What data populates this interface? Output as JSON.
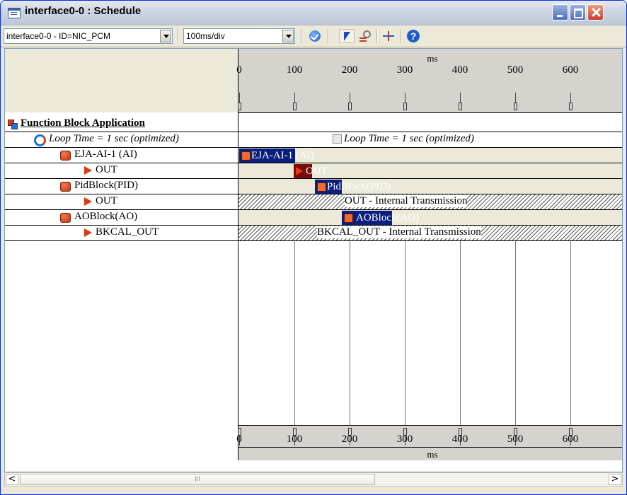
{
  "window": {
    "title": "interface0-0 : Schedule",
    "accent_color": "#0831d9",
    "icon": "schedule-window-icon"
  },
  "toolbar": {
    "interface_select": "interface0-0 - ID=NIC_PCM",
    "scale_select": "100ms/div",
    "buttons": [
      "validate-icon",
      "select-pointer-icon",
      "find-icon",
      "split-icon",
      "help-icon"
    ],
    "help_glyph": "?"
  },
  "timeline": {
    "units": "ms",
    "ticks": [
      "0",
      "100",
      "200",
      "300",
      "400",
      "500",
      "600"
    ]
  },
  "tree": {
    "root": "Function Block Application",
    "loop": "Loop Time = 1 sec (optimized)",
    "rows": [
      {
        "label": "EJA-AI-1 (AI)",
        "type": "block"
      },
      {
        "label": "OUT",
        "type": "output"
      },
      {
        "label": "PidBlock(PID)",
        "type": "block"
      },
      {
        "label": "OUT",
        "type": "output"
      },
      {
        "label": "AOBlock(AO)",
        "type": "block"
      },
      {
        "label": "BKCAL_OUT",
        "type": "output"
      }
    ]
  },
  "lanes": {
    "loop_label": "Loop Time = 1 sec (optimized)",
    "bar1": "EJA-AI-1 (AI)",
    "bar2": "OUT",
    "bar3": "PidBlock(PID)",
    "transmission1": "OUT - Internal Transmission",
    "bar4": "AOBlock(AO)",
    "transmission2": "BKCAL_OUT - Internal Transmission"
  },
  "scrollbar": {
    "left": "<",
    "right": ">",
    "grip": "III"
  }
}
